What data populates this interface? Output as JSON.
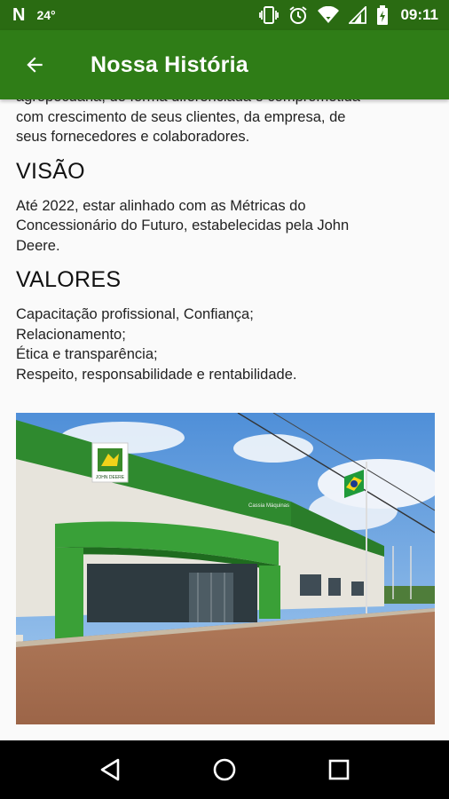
{
  "status_bar": {
    "notification_glyph": "N",
    "temperature": "24°",
    "time": "09:11",
    "icons": [
      "vibrate-icon",
      "alarm-icon",
      "wifi-icon",
      "signal-icon",
      "battery-icon"
    ]
  },
  "app_bar": {
    "title": "Nossa História",
    "back_icon": "arrow-back-icon"
  },
  "content": {
    "intro_lines": [
      "agropecuária, de forma diferenciada e comprometida",
      "com crescimento de seus clientes, da empresa, de",
      "seus fornecedores e colaboradores."
    ],
    "visao": {
      "heading": "VISÃO",
      "lines": [
        "Até 2022, estar alinhado com as Métricas do",
        "Concessionário do Futuro, estabelecidas pela John",
        "Deere."
      ]
    },
    "valores": {
      "heading": "VALORES",
      "items": [
        "Capacitação profissional, Confiança;",
        "Relacionamento;",
        "Ética e transparência;",
        "Respeito, responsabilidade e rentabilidade."
      ]
    },
    "photo": {
      "sign_text": "Cassia Máquinas",
      "logo_text": "JOHN DEERE"
    }
  },
  "colors": {
    "status_bar": "#2a6b12",
    "app_bar": "#2f7d17",
    "background": "#fafafa",
    "nav_bar": "#000000"
  },
  "nav_bar": {
    "buttons": [
      "back-triangle-icon",
      "home-circle-icon",
      "recents-square-icon"
    ]
  }
}
